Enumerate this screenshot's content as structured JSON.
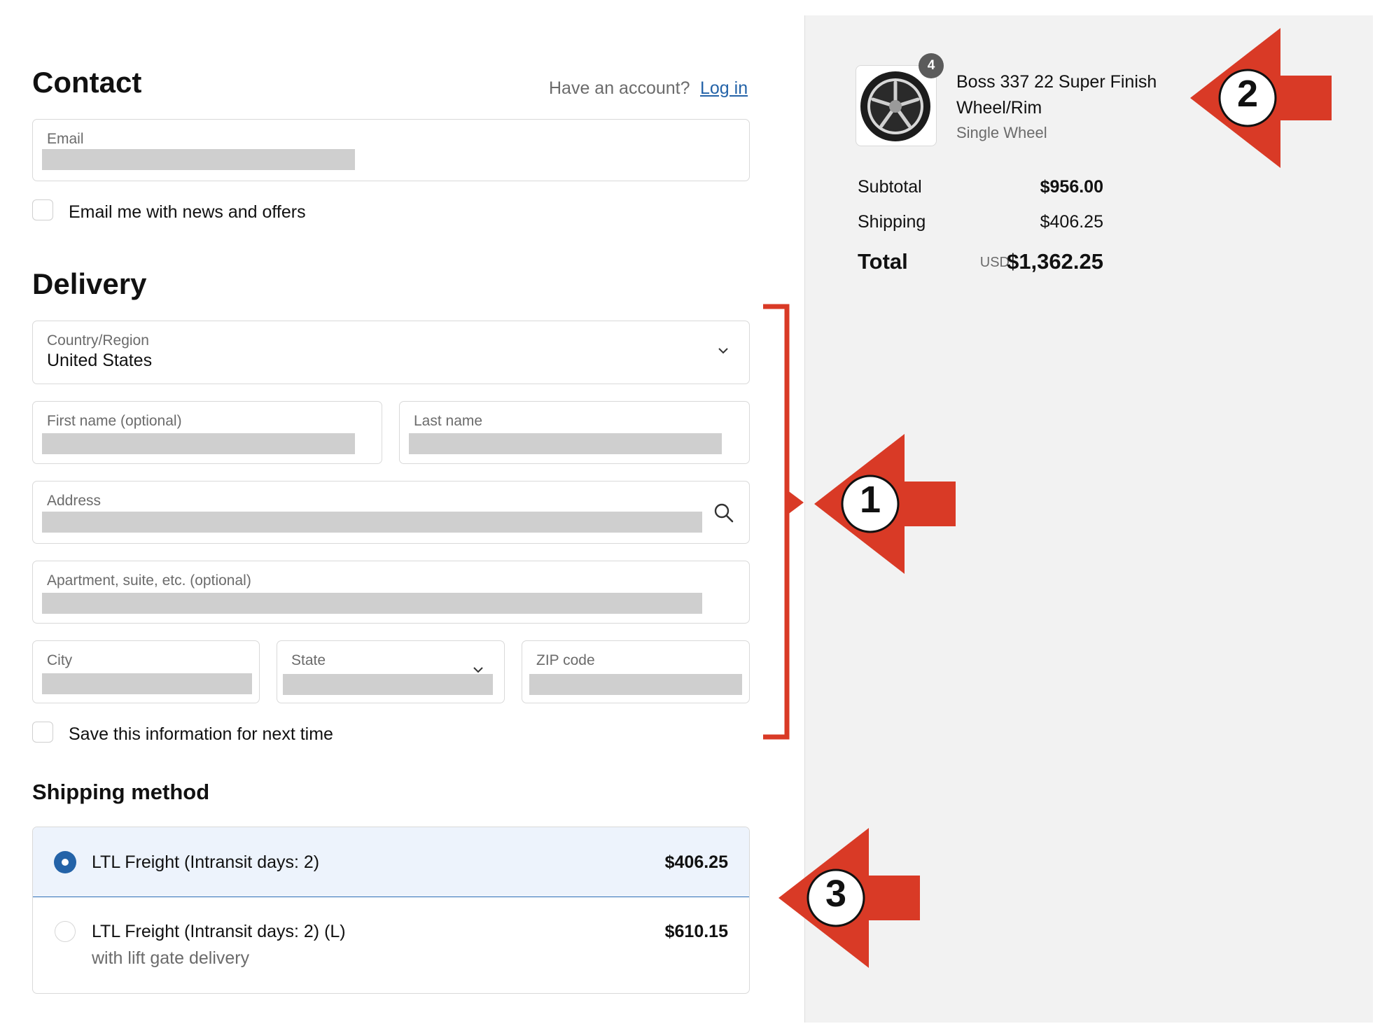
{
  "contact": {
    "title": "Contact",
    "account_prompt": "Have an account?",
    "login_link": "Log in",
    "email_label": "Email",
    "newsletter_label": "Email me with news and offers"
  },
  "delivery": {
    "title": "Delivery",
    "country_label": "Country/Region",
    "country_value": "United States",
    "first_name_label": "First name (optional)",
    "last_name_label": "Last name",
    "address_label": "Address",
    "apartment_label": "Apartment, suite, etc. (optional)",
    "city_label": "City",
    "state_label": "State",
    "zip_label": "ZIP code",
    "save_info_label": "Save this information for next time"
  },
  "shipping_method": {
    "title": "Shipping method",
    "options": [
      {
        "label": "LTL Freight (Intransit days: 2)",
        "price": "$406.25",
        "selected": true
      },
      {
        "label": "LTL Freight (Intransit days: 2) (L)",
        "sub": "with lift gate delivery",
        "price": "$610.15",
        "selected": false
      }
    ]
  },
  "summary": {
    "product": {
      "name_line1": "Boss 337 22 Super Finish",
      "name_line2": "Wheel/Rim",
      "variant": "Single Wheel",
      "quantity": "4"
    },
    "subtotal_label": "Subtotal",
    "subtotal_value": "$956.00",
    "shipping_label": "Shipping",
    "shipping_value": "$406.25",
    "total_label": "Total",
    "total_currency": "USD",
    "total_value": "$1,362.25"
  },
  "annotations": {
    "callout_1": "1",
    "callout_2": "2",
    "callout_3": "3",
    "color": "#d93a26"
  },
  "icons": {
    "chevron": "chevron-down-icon",
    "search": "search-icon"
  }
}
